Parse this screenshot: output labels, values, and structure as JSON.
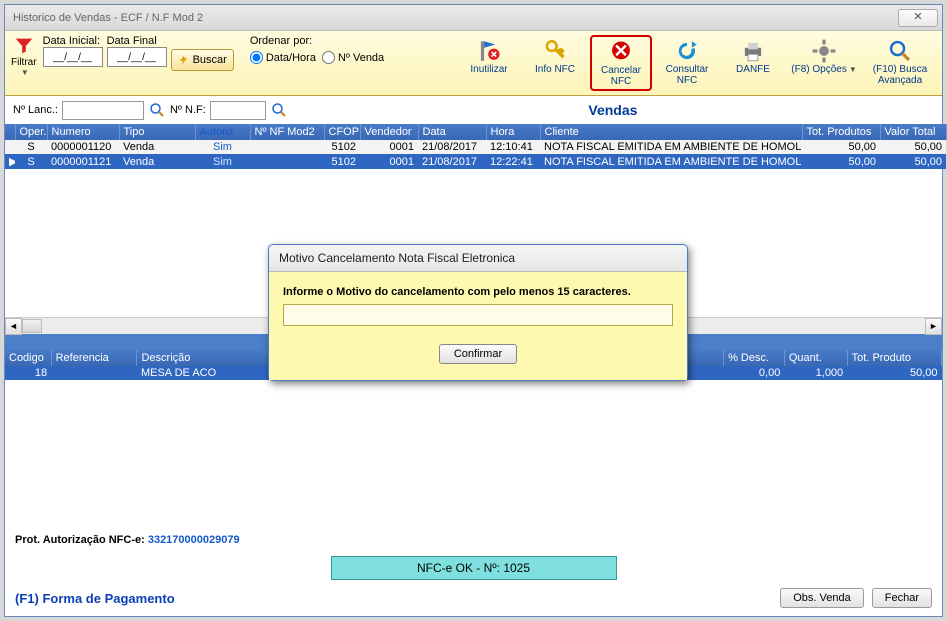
{
  "window": {
    "title": "Historico de Vendas - ECF / N.F Mod 2"
  },
  "toolbar": {
    "filtrar": "Filtrar",
    "data_inicial_label": "Data Inicial:",
    "data_final_label": "Data Final",
    "data_inicial_value": "__/__/__",
    "data_final_value": "__/__/__",
    "buscar": "Buscar",
    "ordenar_por": "Ordenar por:",
    "opt_datahora": "Data/Hora",
    "opt_nvenda": "Nº Venda",
    "btns": {
      "inutilizar": "Inutilizar",
      "info_nfc": "Info NFC",
      "cancelar_nfc": "Cancelar NFC",
      "consultar_nfc": "Consultar NFC",
      "danfe": "DANFE",
      "opcoes": "(F8) Opções",
      "busca_avancada": "(F10) Busca Avançada"
    }
  },
  "filter": {
    "n_lanc_label": "Nº Lanc.:",
    "n_nf_label": "Nº N.F:",
    "vendas_title": "Vendas"
  },
  "sales_header": {
    "oper": "Oper.",
    "numero": "Numero",
    "tipo": "Tipo",
    "autoriz": "Autoriz",
    "nfmod2": "Nº NF Mod2",
    "cfop": "CFOP",
    "vendedor": "Vendedor",
    "data": "Data",
    "hora": "Hora",
    "cliente": "Cliente",
    "tot_produtos": "Tot. Produtos",
    "valor_total": "Valor Total"
  },
  "sales_rows": [
    {
      "oper": "S",
      "numero": "0000001120",
      "tipo": "Venda",
      "autoriz": "Sim",
      "nfmod2": "",
      "cfop": "5102",
      "vendedor": "0001",
      "data": "21/08/2017",
      "hora": "12:10:41",
      "cliente": "NOTA FISCAL EMITIDA EM AMBIENTE DE HOMOLO",
      "totp": "50,00",
      "vtot": "50,00",
      "sel": false
    },
    {
      "oper": "S",
      "numero": "0000001121",
      "tipo": "Venda",
      "autoriz": "Sim",
      "nfmod2": "",
      "cfop": "5102",
      "vendedor": "0001",
      "data": "21/08/2017",
      "hora": "12:22:41",
      "cliente": "NOTA FISCAL EMITIDA EM AMBIENTE DE HOMOLO",
      "totp": "50,00",
      "vtot": "50,00",
      "sel": true
    }
  ],
  "items_header": {
    "codigo": "Codigo",
    "referencia": "Referencia",
    "descricao": "Descrição",
    "pdesc": "% Desc.",
    "quant": "Quant.",
    "totprod": "Tot. Produto"
  },
  "items_rows": [
    {
      "codigo": "18",
      "referencia": "",
      "descricao": "MESA DE ACO",
      "pdesc": "0,00",
      "quant": "1,000",
      "totprod": "50,00"
    }
  ],
  "footer": {
    "prot_label": "Prot. Autorização NFC-e:",
    "prot_num": "332170000029079",
    "nfc_status": "NFC-e OK - Nº: 1025",
    "forma_pag": "(F1) Forma de Pagamento",
    "obs_venda": "Obs. Venda",
    "fechar": "Fechar"
  },
  "modal": {
    "title": "Motivo Cancelamento Nota Fiscal Eletronica",
    "msg": "Informe o Motivo do cancelamento com pelo menos 15 caracteres.",
    "input_value": "",
    "confirm": "Confirmar"
  }
}
